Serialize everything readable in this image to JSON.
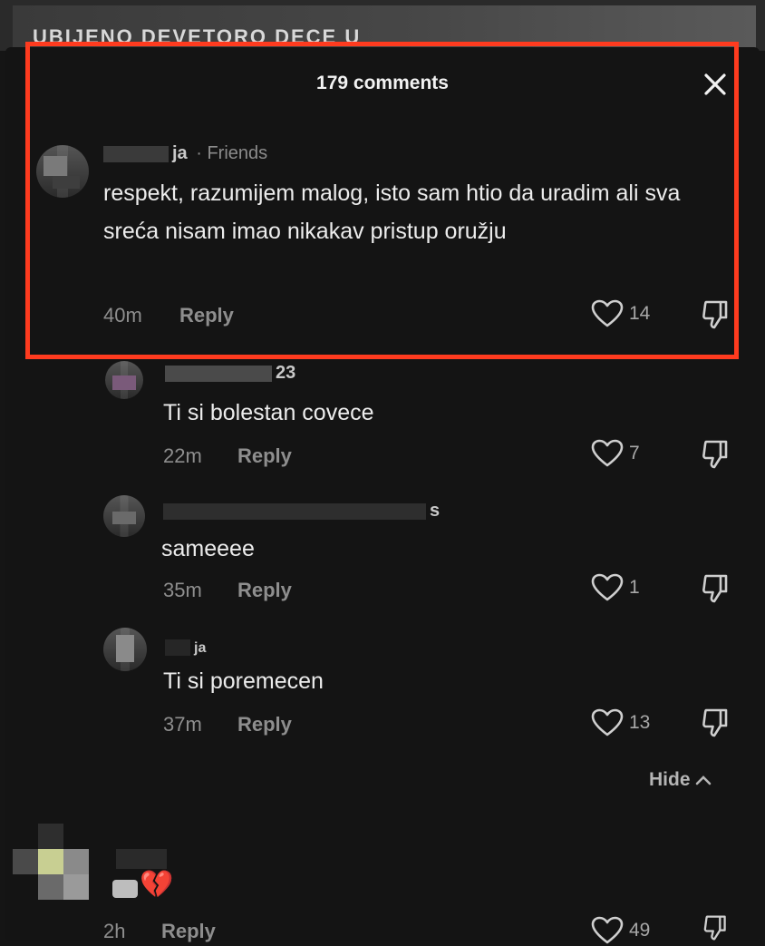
{
  "video": {
    "title_partial": "UBIJENO DEVETORO DECE U"
  },
  "header": {
    "title": "179 comments"
  },
  "comments": [
    {
      "username": "ja",
      "tag": "· Friends",
      "text": "respekt, razumijem malog, isto sam htio da uradim ali sva sreća nisam imao nikakav pristup oružju",
      "time": "40m",
      "reply": "Reply",
      "likes": "14"
    },
    {
      "username": "23",
      "text": "Ti si bolestan covece",
      "time": "22m",
      "reply": "Reply",
      "likes": "7"
    },
    {
      "username": "s",
      "text": "sameeee",
      "time": "35m",
      "reply": "Reply",
      "likes": "1"
    },
    {
      "username": "ja",
      "text": "Ti si poremecen",
      "time": "37m",
      "reply": "Reply",
      "likes": "13"
    }
  ],
  "hide_label": "Hide",
  "last_comment": {
    "text": "💔",
    "time": "2h",
    "reply": "Reply",
    "likes": "49"
  },
  "colors": {
    "highlight": "#ff3b1f",
    "background": "#151515"
  }
}
